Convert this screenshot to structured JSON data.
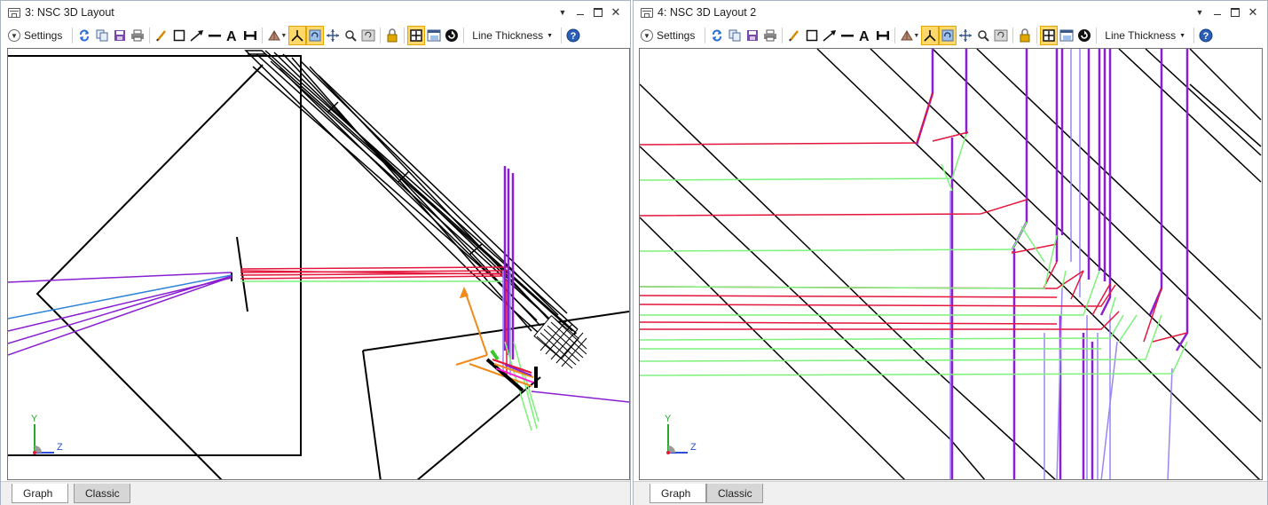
{
  "windows": [
    {
      "title": "3: NSC 3D Layout",
      "toolbar": {
        "settings_label": "Settings",
        "line_thickness_label": "Line Thickness"
      },
      "axes": {
        "y_label": "Y",
        "z_label": "Z"
      },
      "tabs": [
        {
          "label": "Graph",
          "active": true
        },
        {
          "label": "Classic",
          "active": false
        }
      ]
    },
    {
      "title": "4: NSC 3D Layout 2",
      "toolbar": {
        "settings_label": "Settings",
        "line_thickness_label": "Line Thickness"
      },
      "axes": {
        "y_label": "Y",
        "z_label": "Z"
      },
      "tabs": [
        {
          "label": "Graph",
          "active": true
        },
        {
          "label": "Classic",
          "active": false
        }
      ]
    }
  ],
  "toolbar_icons": [
    "settings-chevron-icon",
    "refresh-icon",
    "copy-icon",
    "save-icon",
    "print-icon",
    "pencil-icon",
    "rectangle-icon",
    "arrow-icon",
    "line-icon",
    "text-icon",
    "dimension-icon",
    "rotate-view-icon",
    "axes-icon",
    "rotate-icon",
    "pan-icon",
    "zoom-icon",
    "reset-zoom-icon",
    "lock-icon",
    "fit-icon",
    "window-icon",
    "update-icon",
    "help-icon"
  ],
  "colors": {
    "ray_red": "#e4163c",
    "ray_green": "#7cf279",
    "ray_purple": "#8a1fd1",
    "ray_lavender": "#9a86f5",
    "ray_blue": "#2f84d9",
    "ray_orange": "#f08a1a",
    "active_tool": "#ffd86b",
    "help_blue": "#2a5fb5"
  }
}
